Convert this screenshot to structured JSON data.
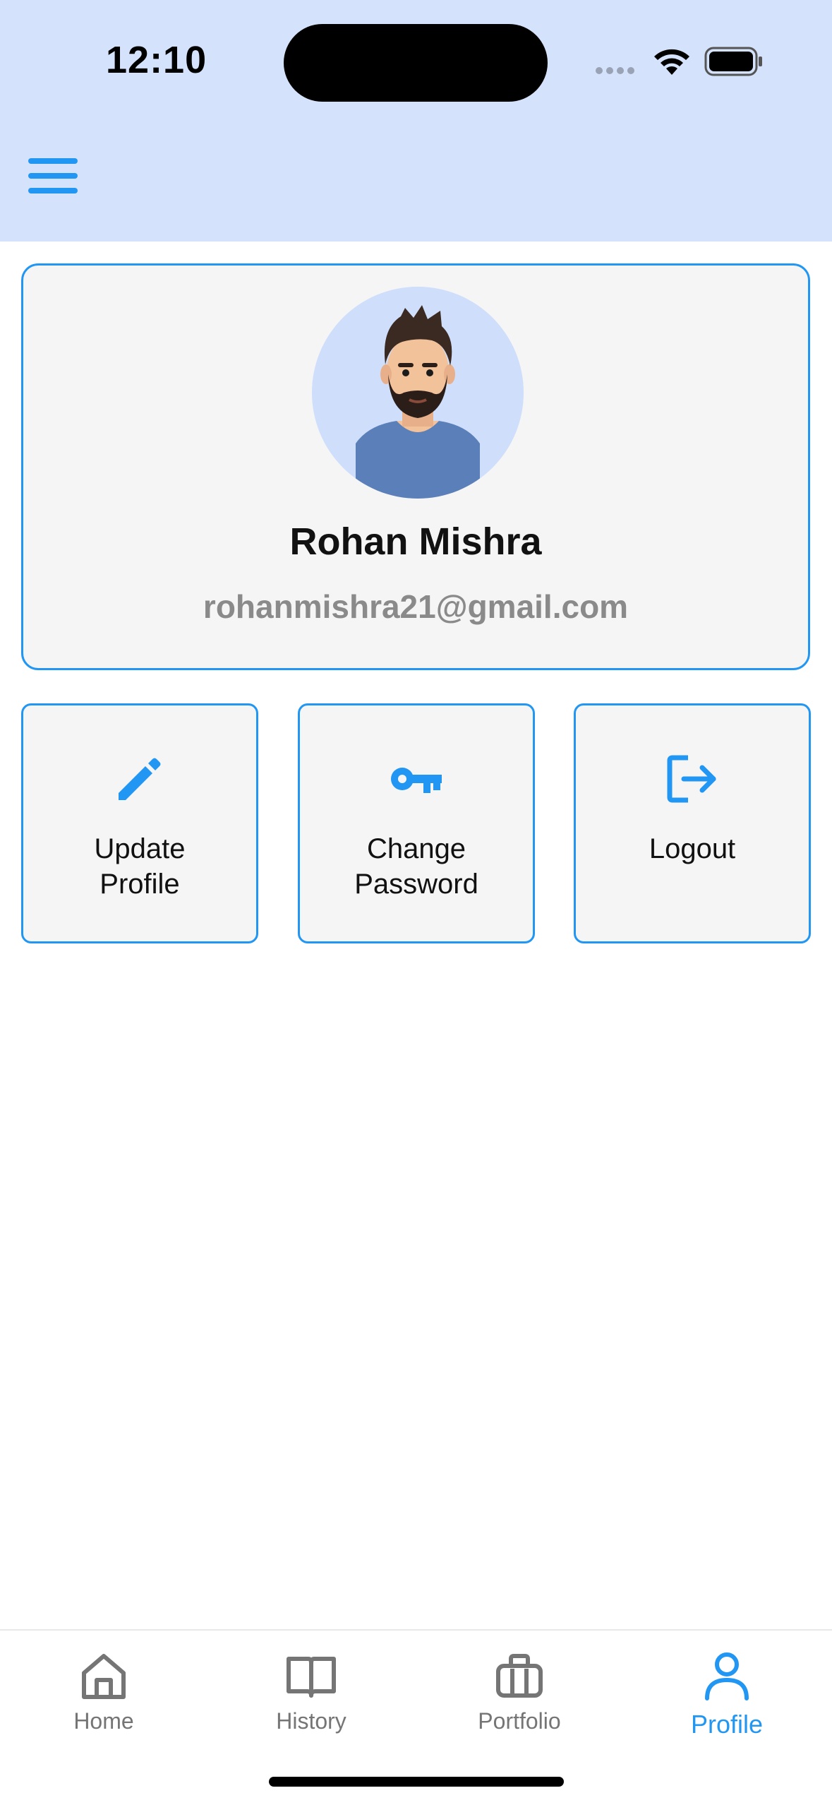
{
  "status_bar": {
    "time": "12:10"
  },
  "header": {
    "menu_icon": "hamburger-menu-icon",
    "background_color": "#d4e2fb"
  },
  "profile": {
    "name": "Rohan Mishra",
    "email": "rohanmishra21@gmail.com",
    "avatar": "avatar-illustration"
  },
  "actions": [
    {
      "label": "Update\nProfile",
      "icon": "pencil-icon"
    },
    {
      "label": "Change\nPassword",
      "icon": "key-icon"
    },
    {
      "label": "Logout",
      "icon": "logout-icon"
    }
  ],
  "bottom_nav": {
    "items": [
      {
        "label": "Home",
        "icon": "home-icon",
        "active": false
      },
      {
        "label": "History",
        "icon": "book-icon",
        "active": false
      },
      {
        "label": "Portfolio",
        "icon": "briefcase-icon",
        "active": false
      },
      {
        "label": "Profile",
        "icon": "person-icon",
        "active": true
      }
    ]
  },
  "colors": {
    "accent": "#2196f3",
    "card_background": "#f5f5f5",
    "inactive_nav": "#757575",
    "email_text": "#8a8a8a"
  }
}
